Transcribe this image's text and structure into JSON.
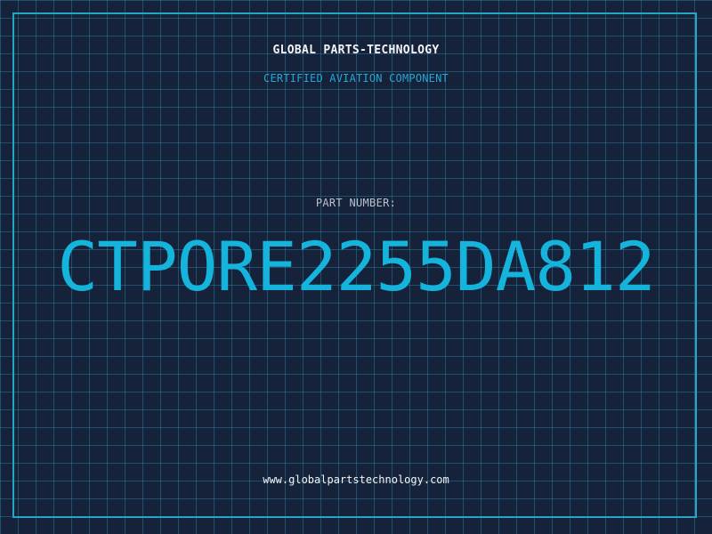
{
  "header": {
    "company_name": "GLOBAL PARTS-TECHNOLOGY",
    "tagline": "CERTIFIED AVIATION COMPONENT"
  },
  "part": {
    "label": "PART NUMBER:",
    "number": "CTPORE2255DA812"
  },
  "footer": {
    "website": "www.globalpartstechnology.com"
  },
  "colors": {
    "background": "#16213a",
    "grid_line": "#2a8aaa",
    "frame_border": "#2aa4c6",
    "accent": "#14b4dc",
    "heading_text": "#f2f4f7",
    "label_text": "#b8c2cc"
  }
}
